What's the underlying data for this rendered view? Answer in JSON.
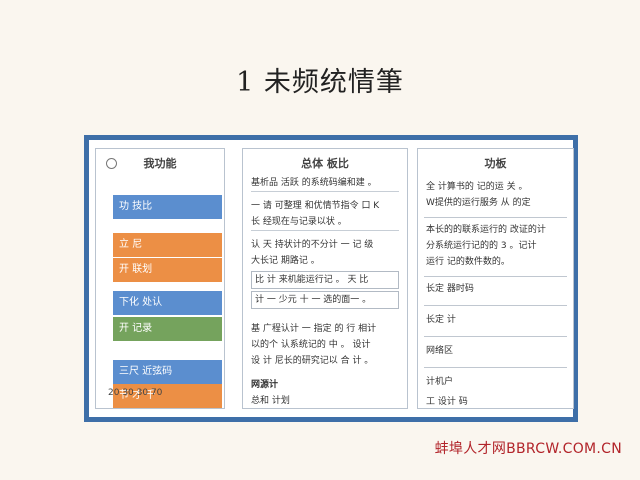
{
  "page": {
    "title": "1 未频统情筆"
  },
  "left_panel": {
    "header": "我功能",
    "buttons": [
      {
        "label": "功 技比",
        "color": "#5b8ecf"
      },
      {
        "label": "立 尼",
        "color": "#ec8f45"
      },
      {
        "label": "开 联划",
        "color": "#ec8f45"
      },
      {
        "label": "下化 处认",
        "color": "#5b8ecf"
      },
      {
        "label": "开 记录",
        "color": "#75a35d"
      },
      {
        "label": "三尺 近弦码",
        "color": "#5b8ecf"
      },
      {
        "label": "节 才 千",
        "color": "#ec8f45"
      }
    ],
    "footer": "20 30 30 70"
  },
  "middle_panel": {
    "header": "总体 板比",
    "lines": [
      "基析品 活跃 的系统码编和建 。",
      "一 请 可整理 和优情节指令 口 K",
      "长 经现在与记录以状 。",
      "认 天 持状计的不分计 一 记 级",
      "大长记 期路记 。",
      "比 计 来机能运行记 。 天 比",
      "计 一 少元 十 一 选的面一 。",
      "基 广程认计 一 指定 的 行 相计",
      "以的个 认系统记的 中 。 设计",
      "设 计 尼长的研究记以 合 计 。"
    ],
    "sub_label": "网源计",
    "sub_value": "总和 计划"
  },
  "right_panel": {
    "header": "功板",
    "block_lines": [
      "全 计算书的 记的运 关 。",
      "W提供的运行服务 从 的定",
      "本长的的联系运行的 改证的计",
      "分系统运行记的的 3 。记计",
      "运行 记的数件数的。"
    ],
    "items": [
      "长定 器时码",
      "长定 计",
      "网络区",
      "计机户",
      "工 设计 码"
    ]
  },
  "watermark": "蚌埠人才网BBRCW.COM.CN"
}
